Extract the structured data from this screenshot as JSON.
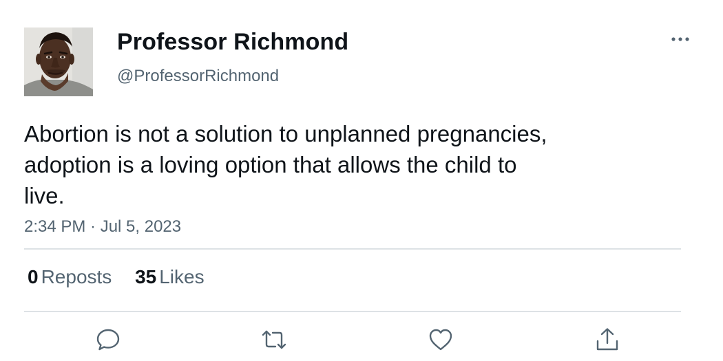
{
  "user": {
    "display_name": "Professor Richmond",
    "handle": "@ProfessorRichmond"
  },
  "tweet": {
    "text": "Abortion is not a solution to unplanned pregnancies,\nadoption is a loving option that allows the child to\nlive.",
    "timestamp": "2:34 PM · Jul 5, 2023"
  },
  "stats": {
    "reposts_count": "0",
    "reposts_label": "Reposts",
    "likes_count": "35",
    "likes_label": "Likes"
  },
  "icons": {
    "more": "more-horizontal-icon",
    "reply": "reply-icon",
    "repost": "repost-icon",
    "like": "heart-icon",
    "share": "share-icon"
  },
  "colors": {
    "text": "#0f1419",
    "secondary": "#536471",
    "divider": "#dde2e5"
  }
}
